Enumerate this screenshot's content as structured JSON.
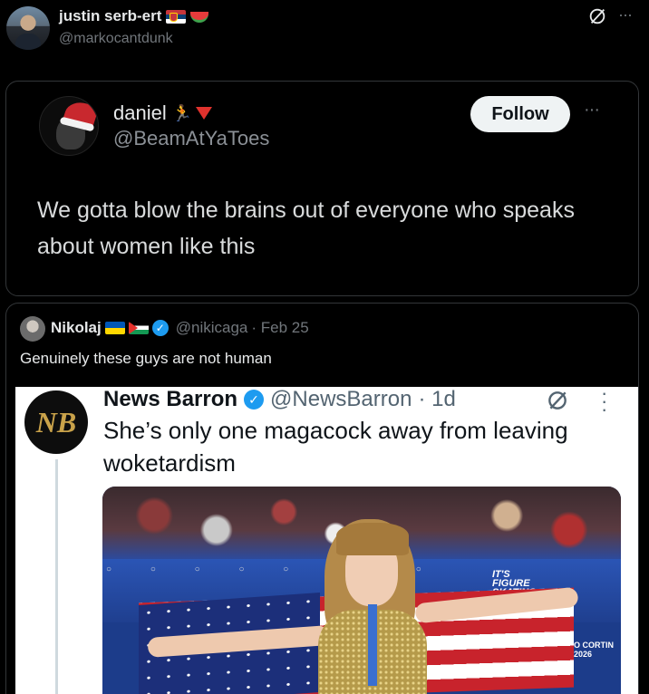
{
  "author": {
    "name": "justin serb-ert",
    "handle": "@markocantdunk"
  },
  "quoted_screenshot": {
    "name": "daniel",
    "handle": "@BeamAtYaToes",
    "follow_label": "Follow",
    "text": "We gotta blow the brains out of everyone who speaks about women like this"
  },
  "quote_tweet": {
    "name": "Nikolaj",
    "handle": "@nikicaga",
    "date": "· Feb 25",
    "text": "Genuinely these guys are not human",
    "embedded": {
      "name": "News Barron",
      "handle": "@NewsBarron",
      "time": "· 1d",
      "avatar_text": "NB",
      "text": "She’s only one magacock away from leaving woketardism",
      "board_text": "IT'S\nFIGURE\nSKATING",
      "board_text2": "O CORTIN\n2026"
    }
  },
  "colors": {
    "background": "#000000",
    "verified": "#1d9bf0",
    "secondary_text": "#71767b"
  },
  "icons": [
    "grok-icon",
    "more-icon",
    "verified-icon",
    "flag-serbia",
    "watermelon-emoji",
    "flag-ukraine",
    "flag-palestine",
    "down-triangle-emoji"
  ]
}
